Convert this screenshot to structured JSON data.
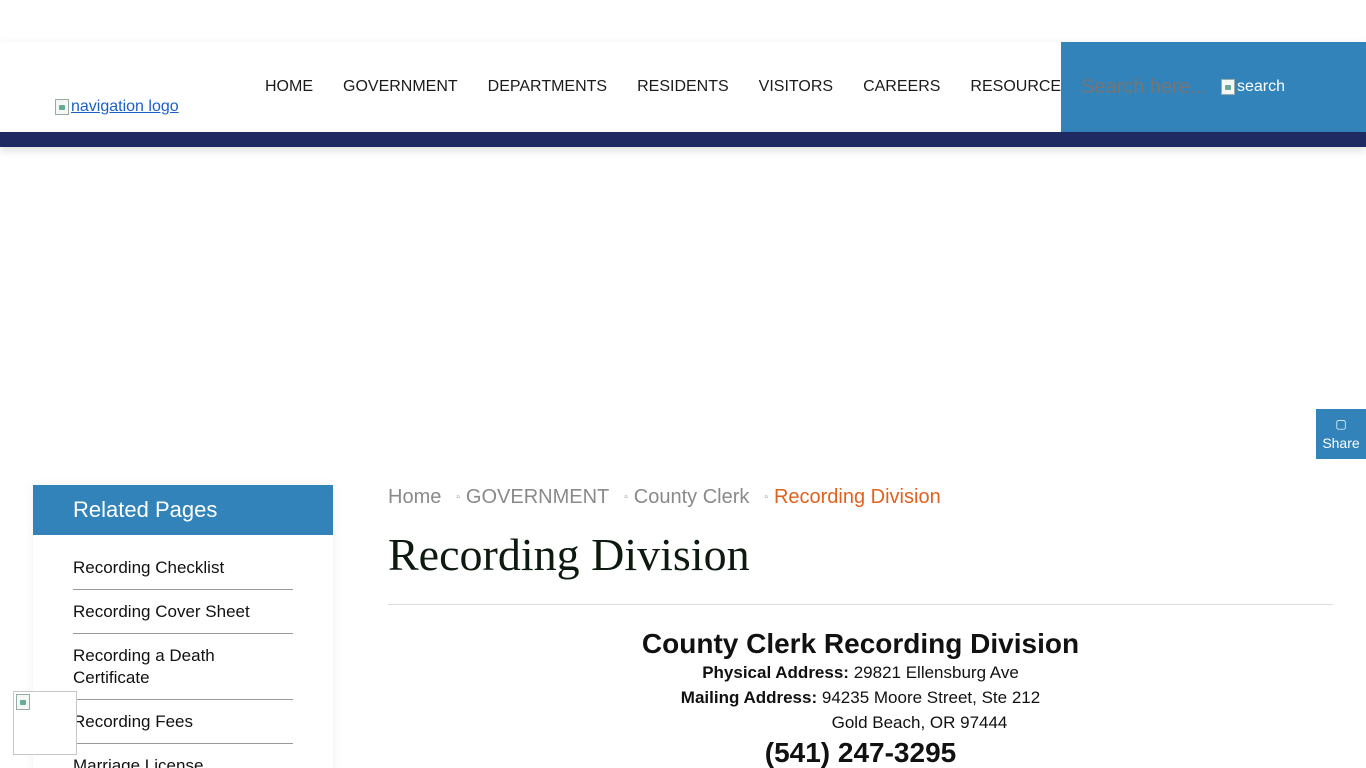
{
  "header": {
    "logo_alt": "navigation logo",
    "nav": [
      "HOME",
      "GOVERNMENT",
      "DEPARTMENTS",
      "RESIDENTS",
      "VISITORS",
      "CAREERS",
      "RESOURCES"
    ],
    "search_placeholder": "Search here...",
    "search_button_alt": "search"
  },
  "share": {
    "label": "Share"
  },
  "sidebar": {
    "title": "Related Pages",
    "items": [
      "Recording Checklist",
      "Recording Cover Sheet",
      "Recording a Death Certificate",
      "Recording Fees",
      "Marriage License"
    ]
  },
  "breadcrumb": {
    "items": [
      "Home",
      "GOVERNMENT",
      "County Clerk"
    ],
    "current": "Recording Division"
  },
  "page": {
    "title": "Recording Division",
    "heading": "County Clerk Recording Division",
    "physical_label": "Physical Address:",
    "physical_value": "29821 Ellensburg Ave",
    "mailing_label": "Mailing Address:",
    "mailing_value": "94235 Moore Street, Ste 212",
    "city_line": "Gold Beach, OR 97444",
    "phone": "(541) 247-3295"
  },
  "colors": {
    "accent": "#3183b9",
    "navy": "#1f2a63",
    "breadcrumb_current": "#e0621e"
  }
}
